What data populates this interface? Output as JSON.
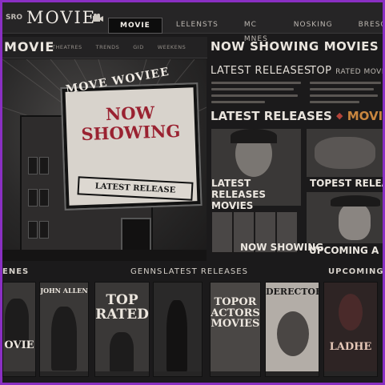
{
  "header": {
    "brand_small": "SRO",
    "brand": "MOVIE",
    "nav": [
      "MOVIE",
      "LELENSTS",
      "MC MNES",
      "NOSKING",
      "BRESONE"
    ],
    "active_nav": "MOVIE"
  },
  "subnav": {
    "logo": "MOVIE",
    "items": [
      "THEATRES",
      "TRENDS",
      "GID",
      "WEEKENS"
    ]
  },
  "hero": {
    "marquee_top": "MOVE WOVIEE",
    "marquee_main": "NOW SHOWING",
    "release_sign": "LATEST RELEASE"
  },
  "right_panel": {
    "headline_a": "NOW SHOWING",
    "headline_b": "MOVIES",
    "col_left_title": "LATEST RELEASES",
    "col_right_title": "TOP",
    "col_right_small": "RATED MOVIE",
    "banner_a": "LATEST RELEASES",
    "banner_b": "MOVIE",
    "tile_left_label": "LATEST RELEASES MOVIES",
    "tile_right_label": "TOPEST RELEASE",
    "tile_bottom_left_label": "NOW SHOWING",
    "tile_bottom_right_label": "UPCOMING A"
  },
  "bottom": {
    "headers": [
      "ENES",
      "GENNS",
      "LATEST RELEASES",
      "UPCOMING"
    ],
    "posters": [
      {
        "text": "OVIE"
      },
      {
        "text": "JOHN ALLEN"
      },
      {
        "text": "TOP RATED"
      },
      {
        "text": ""
      },
      {
        "text": "TOPOR ACTORS MOVIES"
      },
      {
        "text": "DERECTORS"
      },
      {
        "text": "LADHE"
      }
    ]
  },
  "colors": {
    "frame": "#8a2fc3",
    "accent_red": "#9a2231",
    "accent_orange": "#c9863f"
  }
}
